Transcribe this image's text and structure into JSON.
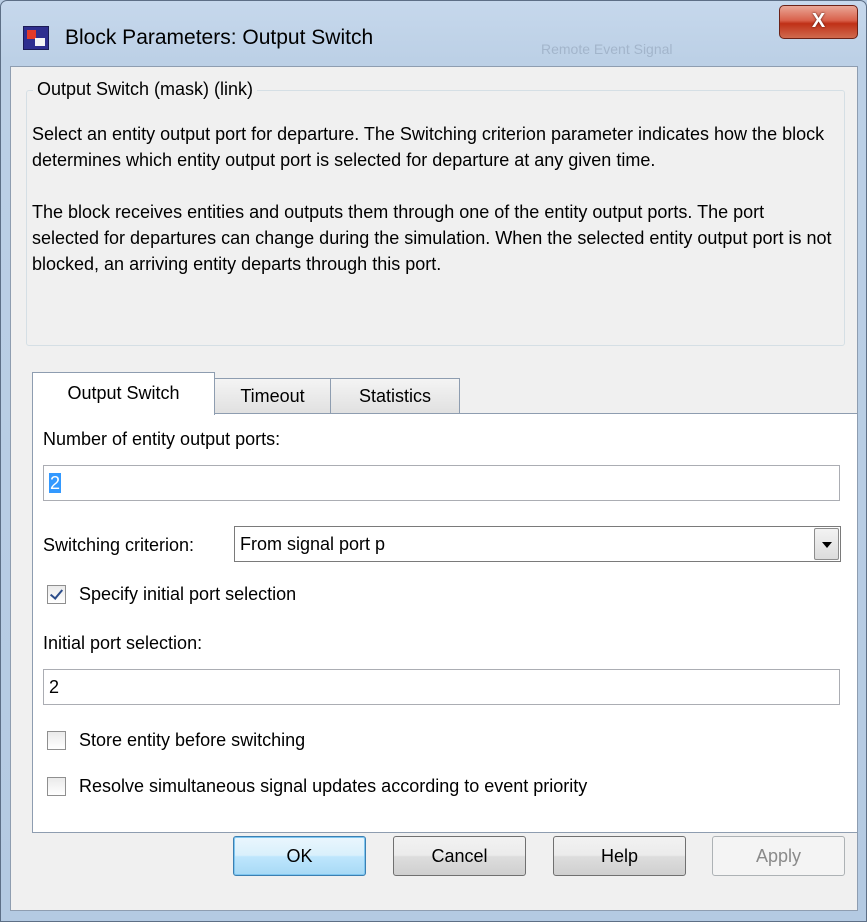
{
  "window": {
    "title": "Block Parameters: Output Switch",
    "close_label": "X",
    "background_text": "Remote Event Signal"
  },
  "group": {
    "title": "Output Switch (mask) (link)",
    "description": [
      "Select an entity output port for departure. The Switching criterion parameter indicates how the block determines which entity output port is selected for departure at any given time.",
      "The block receives entities and outputs them through one of the entity output ports. The port selected for departures can change during the simulation. When the selected entity output port is not blocked, an arriving entity departs through this port."
    ]
  },
  "tabs": [
    {
      "label": "Output Switch",
      "active": true
    },
    {
      "label": "Timeout",
      "active": false
    },
    {
      "label": "Statistics",
      "active": false
    }
  ],
  "fields": {
    "num_ports_label": "Number of entity output ports:",
    "num_ports_value": "2",
    "criterion_label": "Switching criterion:",
    "criterion_value": "From signal port p",
    "specify_initial_label": "Specify initial port selection",
    "specify_initial_checked": true,
    "initial_port_label": "Initial port selection:",
    "initial_port_value": "2",
    "store_entity_label": "Store entity before switching",
    "store_entity_checked": false,
    "resolve_label": "Resolve simultaneous signal updates according to event priority",
    "resolve_checked": false
  },
  "buttons": {
    "ok": "OK",
    "cancel": "Cancel",
    "help": "Help",
    "apply": "Apply"
  }
}
